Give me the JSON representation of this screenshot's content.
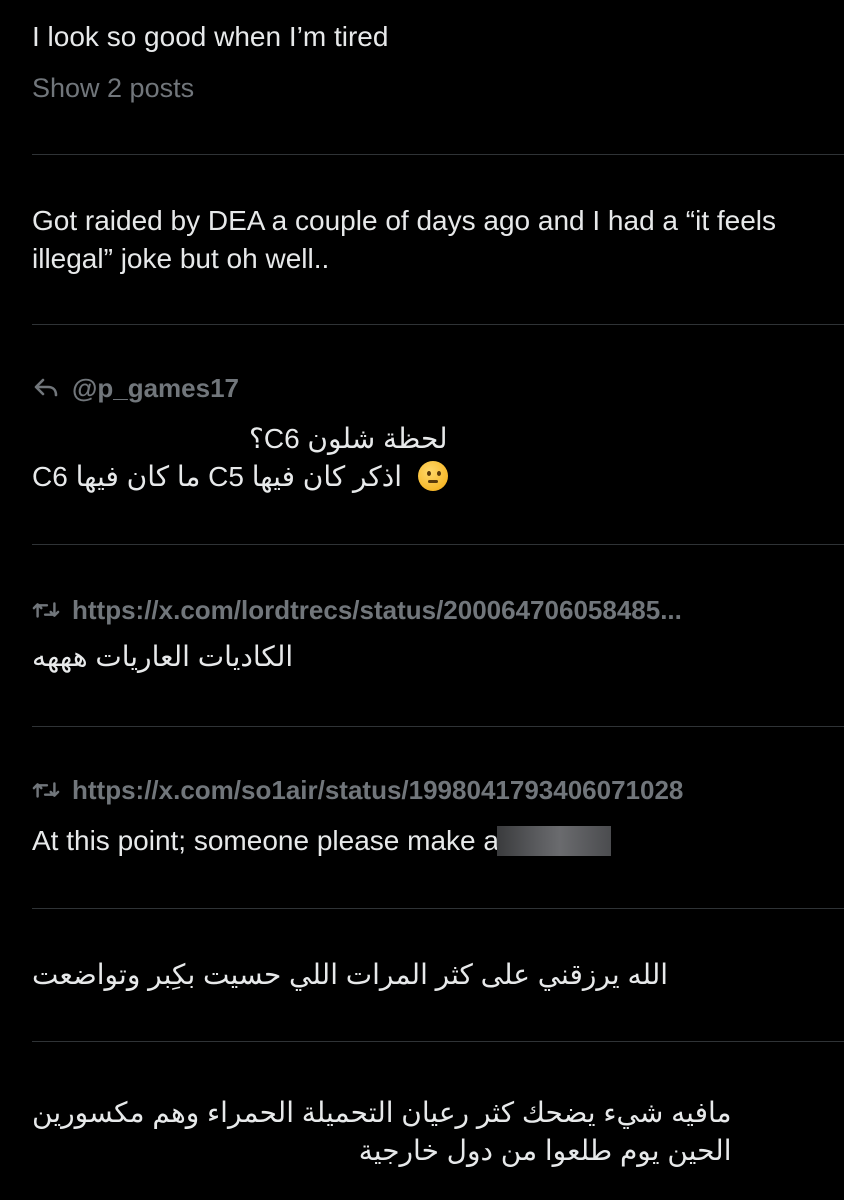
{
  "posts": [
    {
      "text": "I look so good when I’m tired",
      "show_more": "Show 2 posts"
    },
    {
      "text": "Got raided by DEA a couple of days ago and I had a “it feels illegal” joke but oh well.."
    },
    {
      "context_icon": "reply-arrow-icon",
      "context": "@p_games17",
      "lines": [
        "لحظة شلون C6؟",
        "اذكر كان فيها C5 ما كان فيها C6"
      ],
      "emoji": "thinking-face"
    },
    {
      "context_icon": "retweet-icon",
      "context": "https://x.com/lordtrecs/status/200064706058485...",
      "text": "الكاديات العاريات هههه"
    },
    {
      "context_icon": "retweet-icon",
      "context": "https://x.com/so1air/status/1998041793406071028",
      "text": "At this point; someone please make a"
    },
    {
      "text": "الله يرزقني على كثر المرات اللي حسيت بكِبر وتواضعت"
    },
    {
      "lines": [
        "مافيه شيء يضحك كثر رعيان التحميلة الحمراء وهم مكسورين",
        "الحين يوم طلعوا من دول خارجية"
      ]
    }
  ],
  "colors": {
    "background": "#000000",
    "text": "#e7e9ea",
    "muted": "#71767b",
    "divider": "#2f3336"
  }
}
